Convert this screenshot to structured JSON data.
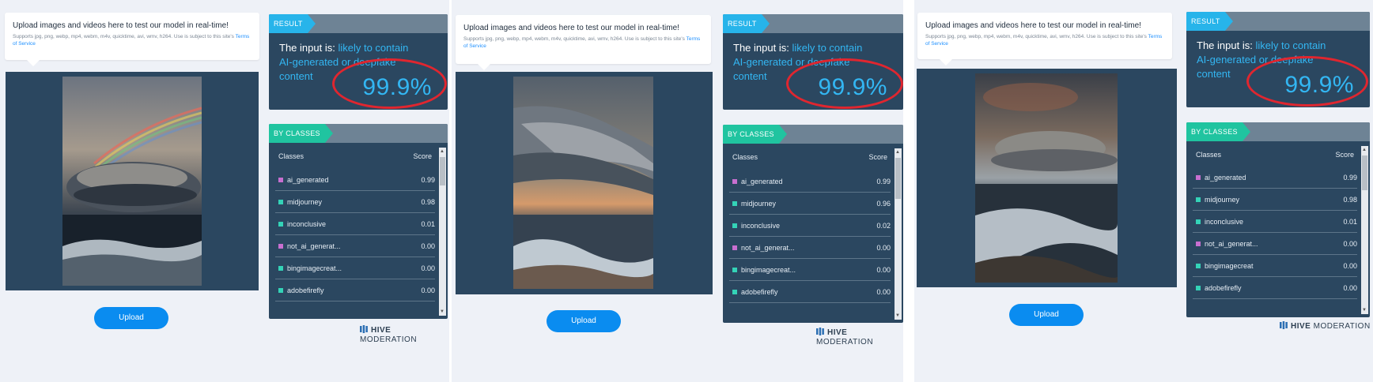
{
  "panels": [
    {
      "upload": {
        "title": "Upload images and videos here to test our model in real-time!",
        "subtitle": "Supports jpg, png, webp, mp4, webm, m4v, quicktime, avi, wmv, h264. Use is subject to this site's",
        "tos": "Terms of Service",
        "button": "Upload"
      },
      "result": {
        "tag": "RESULT",
        "prefix": "The input is:",
        "verdict": "likely to contain AI-generated or deepfake content",
        "score": "99.9%"
      },
      "classes": {
        "tag": "BY CLASSES",
        "col_classes": "Classes",
        "col_score": "Score",
        "rows": [
          {
            "name": "ai_generated",
            "score": "0.99",
            "color": "#c86fd0"
          },
          {
            "name": "midjourney",
            "score": "0.98",
            "color": "#34d3b7"
          },
          {
            "name": "inconclusive",
            "score": "0.01",
            "color": "#34d3b7"
          },
          {
            "name": "not_ai_generat...",
            "score": "0.00",
            "color": "#c86fd0"
          },
          {
            "name": "bingimagecreat...",
            "score": "0.00",
            "color": "#34d3b7"
          },
          {
            "name": "adobefirefly",
            "score": "0.00",
            "color": "#34d3b7"
          }
        ]
      },
      "brand": {
        "strong": "HIVE",
        "rest": "MODERATION"
      }
    },
    {
      "upload": {
        "title": "Upload images and videos here to test our model in real-time!",
        "subtitle": "Supports jpg, png, webp, mp4, webm, m4v, quicktime, avi, wmv, h264. Use is subject to this site's",
        "tos": "Terms of Service",
        "button": "Upload"
      },
      "result": {
        "tag": "RESULT",
        "prefix": "The input is:",
        "verdict": "likely to contain AI-generated or deepfake content",
        "score": "99.9%"
      },
      "classes": {
        "tag": "BY CLASSES",
        "col_classes": "Classes",
        "col_score": "Score",
        "rows": [
          {
            "name": "ai_generated",
            "score": "0.99",
            "color": "#c86fd0"
          },
          {
            "name": "midjourney",
            "score": "0.96",
            "color": "#34d3b7"
          },
          {
            "name": "inconclusive",
            "score": "0.02",
            "color": "#34d3b7"
          },
          {
            "name": "not_ai_generat...",
            "score": "0.00",
            "color": "#c86fd0"
          },
          {
            "name": "bingimagecreat...",
            "score": "0.00",
            "color": "#34d3b7"
          },
          {
            "name": "adobefirefly",
            "score": "0.00",
            "color": "#34d3b7"
          }
        ]
      },
      "brand": {
        "strong": "HIVE",
        "rest": "MODERATION"
      }
    },
    {
      "upload": {
        "title": "Upload images and videos here to test our model in real-time!",
        "subtitle": "Supports jpg, png, webp, mp4, webm, m4v, quicktime, avi, wmv, h264. Use is subject to this site's",
        "tos": "Terms of Service",
        "button": "Upload"
      },
      "result": {
        "tag": "RESULT",
        "prefix": "The input is:",
        "verdict": "likely to contain AI-generated or deepfake content",
        "score": "99.9%"
      },
      "classes": {
        "tag": "BY CLASSES",
        "col_classes": "Classes",
        "col_score": "Score",
        "rows": [
          {
            "name": "ai_generated",
            "score": "0.99",
            "color": "#c86fd0"
          },
          {
            "name": "midjourney",
            "score": "0.98",
            "color": "#34d3b7"
          },
          {
            "name": "inconclusive",
            "score": "0.01",
            "color": "#34d3b7"
          },
          {
            "name": "not_ai_generat...",
            "score": "0.00",
            "color": "#c86fd0"
          },
          {
            "name": "bingimagecreat",
            "score": "0.00",
            "color": "#34d3b7"
          },
          {
            "name": "adobefirefly",
            "score": "0.00",
            "color": "#34d3b7"
          }
        ]
      },
      "brand": {
        "strong": "HIVE",
        "rest": "MODERATION"
      }
    }
  ]
}
